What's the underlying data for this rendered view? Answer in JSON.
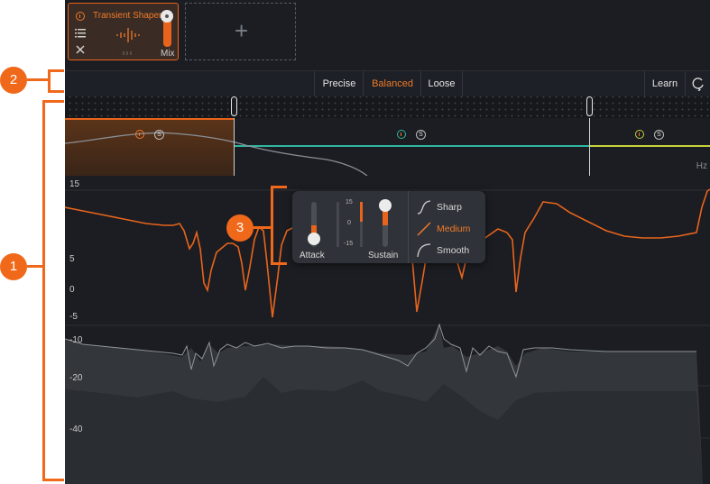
{
  "module": {
    "title": "Transient Shaper",
    "mix_label": "Mix",
    "mix_value": 1.0
  },
  "add_slot": {
    "symbol": "+"
  },
  "modes": {
    "options": [
      "Precise",
      "Balanced",
      "Loose"
    ],
    "selected": "Balanced",
    "learn_label": "Learn"
  },
  "crossover": {
    "unit": "Hz",
    "solo_label": "S"
  },
  "graph": {
    "ticks": [
      "15",
      "5",
      "0",
      "-5",
      "-10",
      "-20",
      "-40"
    ]
  },
  "popup": {
    "attack_label": "Attack",
    "sustain_label": "Sustain",
    "meter_ticks": [
      "15",
      "0",
      "-15"
    ],
    "shapes": [
      "Sharp",
      "Medium",
      "Smooth"
    ],
    "selected_shape": "Medium"
  },
  "callouts": [
    "1",
    "2",
    "3"
  ],
  "colors": {
    "accent": "#e8641c",
    "band1": "#f07a2a",
    "band2": "#2fb7a0",
    "band3": "#c8d23a",
    "background": "#1b1d22"
  }
}
